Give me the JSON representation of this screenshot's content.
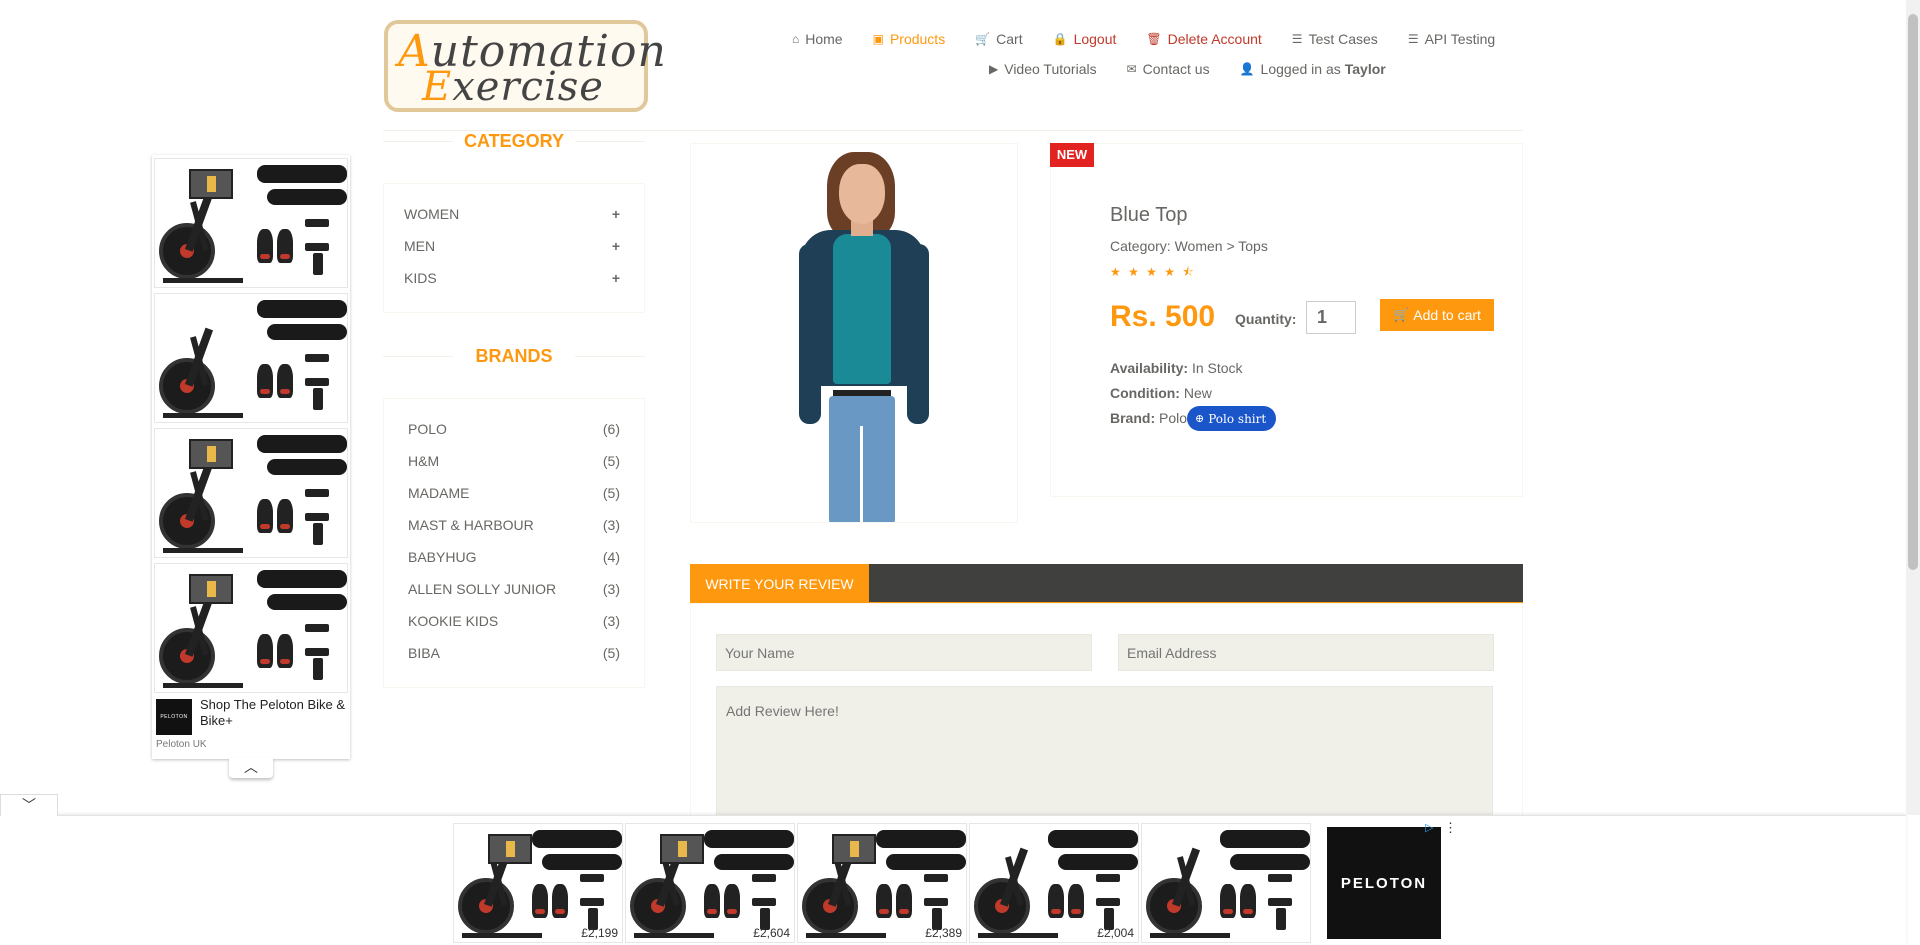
{
  "logo": {
    "line1_cap": "A",
    "line1_rest": "utomation",
    "line2_cap": "E",
    "line2_rest": "xercise"
  },
  "nav": {
    "row1": [
      {
        "label": "Home",
        "icon": "home-icon",
        "glyph": "⌂"
      },
      {
        "label": "Products",
        "icon": "products-icon",
        "glyph": "▣"
      },
      {
        "label": "Cart",
        "icon": "cart-icon",
        "glyph": "🛒"
      },
      {
        "label": "Logout",
        "icon": "lock-icon",
        "glyph": "🔒"
      },
      {
        "label": "Delete Account",
        "icon": "trash-icon",
        "glyph": "🗑"
      },
      {
        "label": "Test Cases",
        "icon": "list-icon",
        "glyph": "☰"
      },
      {
        "label": "API Testing",
        "icon": "list-icon",
        "glyph": "☰"
      }
    ],
    "row2": [
      {
        "label": "Video Tutorials",
        "icon": "youtube-icon",
        "glyph": "▶"
      },
      {
        "label": "Contact us",
        "icon": "envelope-icon",
        "glyph": "✉"
      },
      {
        "label": "Logged in as",
        "icon": "user-icon",
        "glyph": "👤",
        "user": "Taylor"
      }
    ]
  },
  "side_ad": {
    "adchoices": "▷",
    "menu": "⋮",
    "title": "Shop The Peloton Bike & Bike+",
    "advertiser": "Peloton UK",
    "logo_text": "PELOTON",
    "collapse": "︿"
  },
  "sidebar": {
    "category_title": "CATEGORY",
    "categories": [
      {
        "label": "WOMEN"
      },
      {
        "label": "MEN"
      },
      {
        "label": "KIDS"
      }
    ],
    "plus": "+",
    "brands_title": "BRANDS",
    "brands": [
      {
        "name": "POLO",
        "count": "(6)"
      },
      {
        "name": "H&M",
        "count": "(5)"
      },
      {
        "name": "MADAME",
        "count": "(5)"
      },
      {
        "name": "MAST & HARBOUR",
        "count": "(3)"
      },
      {
        "name": "BABYHUG",
        "count": "(4)"
      },
      {
        "name": "ALLEN SOLLY JUNIOR",
        "count": "(3)"
      },
      {
        "name": "KOOKIE KIDS",
        "count": "(3)"
      },
      {
        "name": "BIBA",
        "count": "(5)"
      }
    ]
  },
  "product": {
    "badge": "NEW",
    "name": "Blue Top",
    "category": "Category: Women > Tops",
    "stars": "★ ★ ★ ★ ⯪",
    "rating": 4.5,
    "price": "Rs. 500",
    "quantity_label": "Quantity:",
    "quantity": "1",
    "add_to_cart": "Add to cart",
    "availability_label": "Availability:",
    "availability": "In Stock",
    "condition_label": "Condition:",
    "condition": "New",
    "brand_label": "Brand:",
    "brand": "Polo",
    "chip": "Polo shirt"
  },
  "review": {
    "tab": "WRITE YOUR REVIEW",
    "name_placeholder": "Your Name",
    "email_placeholder": "Email Address",
    "review_placeholder": "Add Review Here!"
  },
  "bottom_ad": {
    "prices": [
      "£2,199",
      "£2,604",
      "£2,389",
      "£2,004"
    ],
    "brand": "PELOTON",
    "adchoices": "▷",
    "menu": "⋮",
    "collapse": "﹀"
  },
  "colors": {
    "accent": "#fe980f",
    "badge": "#e32222",
    "chip": "#1a56c9",
    "review_bar": "#40403e"
  }
}
